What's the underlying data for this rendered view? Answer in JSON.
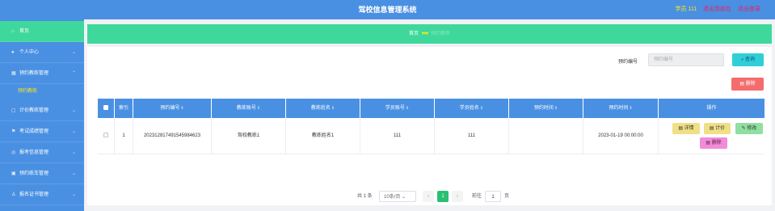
{
  "header": {
    "title": "驾校信息管理系统",
    "role": "学员 111",
    "exit_to_front": "退出到前台",
    "logout": "退出登录"
  },
  "sidebar": {
    "items": [
      {
        "label": "首页",
        "icon": "home-icon"
      },
      {
        "label": "个人中心",
        "icon": "user-icon"
      },
      {
        "label": "预约教练管理",
        "icon": "grid-icon"
      },
      {
        "label": "计价教练管理",
        "icon": "clipboard-icon"
      },
      {
        "label": "考试成绩管理",
        "icon": "flag-icon"
      },
      {
        "label": "报考信息管理",
        "icon": "target-icon"
      },
      {
        "label": "预约练车管理",
        "icon": "car-icon"
      },
      {
        "label": "报名证书管理",
        "icon": "certificate-icon"
      }
    ],
    "active_sub": "预约教练"
  },
  "breadcrumb": {
    "home": "首页",
    "hearts": "♥♥♥",
    "current": "预约教练"
  },
  "search": {
    "label": "预约编号",
    "placeholder": "预约编号",
    "query_label": "查询"
  },
  "toolbar": {
    "delete_label": "删除"
  },
  "table": {
    "headers": [
      "索引",
      "预约编号",
      "教练账号",
      "教练姓名",
      "学员账号",
      "学员姓名",
      "预约时间",
      "预约时间",
      "操作"
    ],
    "rows": [
      {
        "index": "1",
        "booking_no": "202312817491545984623",
        "coach_account": "驾校教练1",
        "coach_name": "教练姓名1",
        "student_account": "111",
        "student_name": "111",
        "booking_time": "",
        "appointment_time": "2023-01-19 00:00:00"
      }
    ],
    "actions": {
      "detail": "详情",
      "pay": "计价",
      "edit": "修改",
      "delete": "删除"
    }
  },
  "pagination": {
    "total": "共 1 条",
    "page_size": "10条/页",
    "current_page": "1",
    "goto": "前往",
    "goto_value": "1",
    "page_suffix": "页"
  },
  "colors": {
    "primary": "#4a90e2",
    "accent_green": "#3fd89c",
    "warning_yellow": "#f8e71c",
    "danger": "#f56c6c"
  }
}
